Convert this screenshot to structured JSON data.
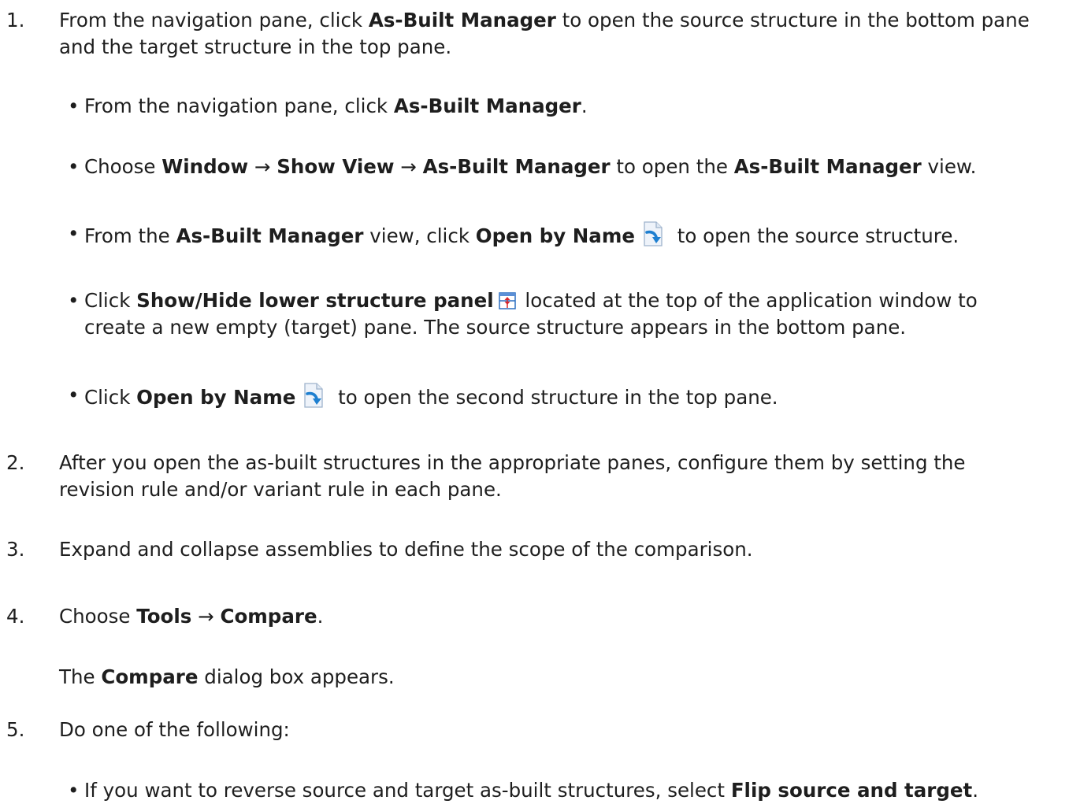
{
  "steps": [
    {
      "number": "1.",
      "line1_pre": "From the navigation pane, click ",
      "line1_bold": "As-Built Manager",
      "line1_post": " to open the source structure in the bottom pane",
      "line2": "and the target structure in the top pane.",
      "substeps": [
        {
          "bullet": "•",
          "pre": "From the navigation pane, click ",
          "bold": "As-Built Manager",
          "post": "."
        },
        {
          "bullet": "•",
          "pre": "Choose ",
          "b1": "Window",
          "a1": " → ",
          "b2": "Show View",
          "a2": " → ",
          "b3": "As-Built Manager",
          "mid": " to open the ",
          "b4": "As-Built Manager",
          "post": " view."
        },
        {
          "bullet": "•",
          "pre": "From the ",
          "b1": "As-Built Manager",
          "mid": " view, click ",
          "b2": "Open by Name",
          "post": " to open the source structure."
        },
        {
          "bullet": "•",
          "pre": "Click ",
          "bold": "Show/Hide lower structure panel",
          "post": " located at the top of the application window to",
          "line2": "create a new empty (target) pane. The source structure appears in the bottom pane."
        },
        {
          "bullet": "•",
          "pre": "Click ",
          "bold": "Open by Name",
          "post": " to open the second structure in the top pane."
        }
      ]
    },
    {
      "number": "2.",
      "line1": "After you open the as-built structures in the appropriate panes, configure them by setting the",
      "line2": "revision rule and/or variant rule in each pane."
    },
    {
      "number": "3.",
      "line1": "Expand and collapse assemblies to define the scope of the comparison."
    },
    {
      "number": "4.",
      "pre": "Choose ",
      "b1": "Tools",
      "arrow": " → ",
      "b2": "Compare",
      "post": ".",
      "note_pre": "The ",
      "note_bold": "Compare",
      "note_post": " dialog box appears."
    },
    {
      "number": "5.",
      "line1": "Do one of the following:",
      "substep": {
        "bullet": "•",
        "pre": "If you want to reverse source and target as-built structures, select ",
        "bold": "Flip source and target",
        "post": "."
      }
    }
  ],
  "icons": {
    "open_by_name": "open-by-name-icon",
    "show_hide_panel": "show-hide-lower-panel-icon"
  }
}
